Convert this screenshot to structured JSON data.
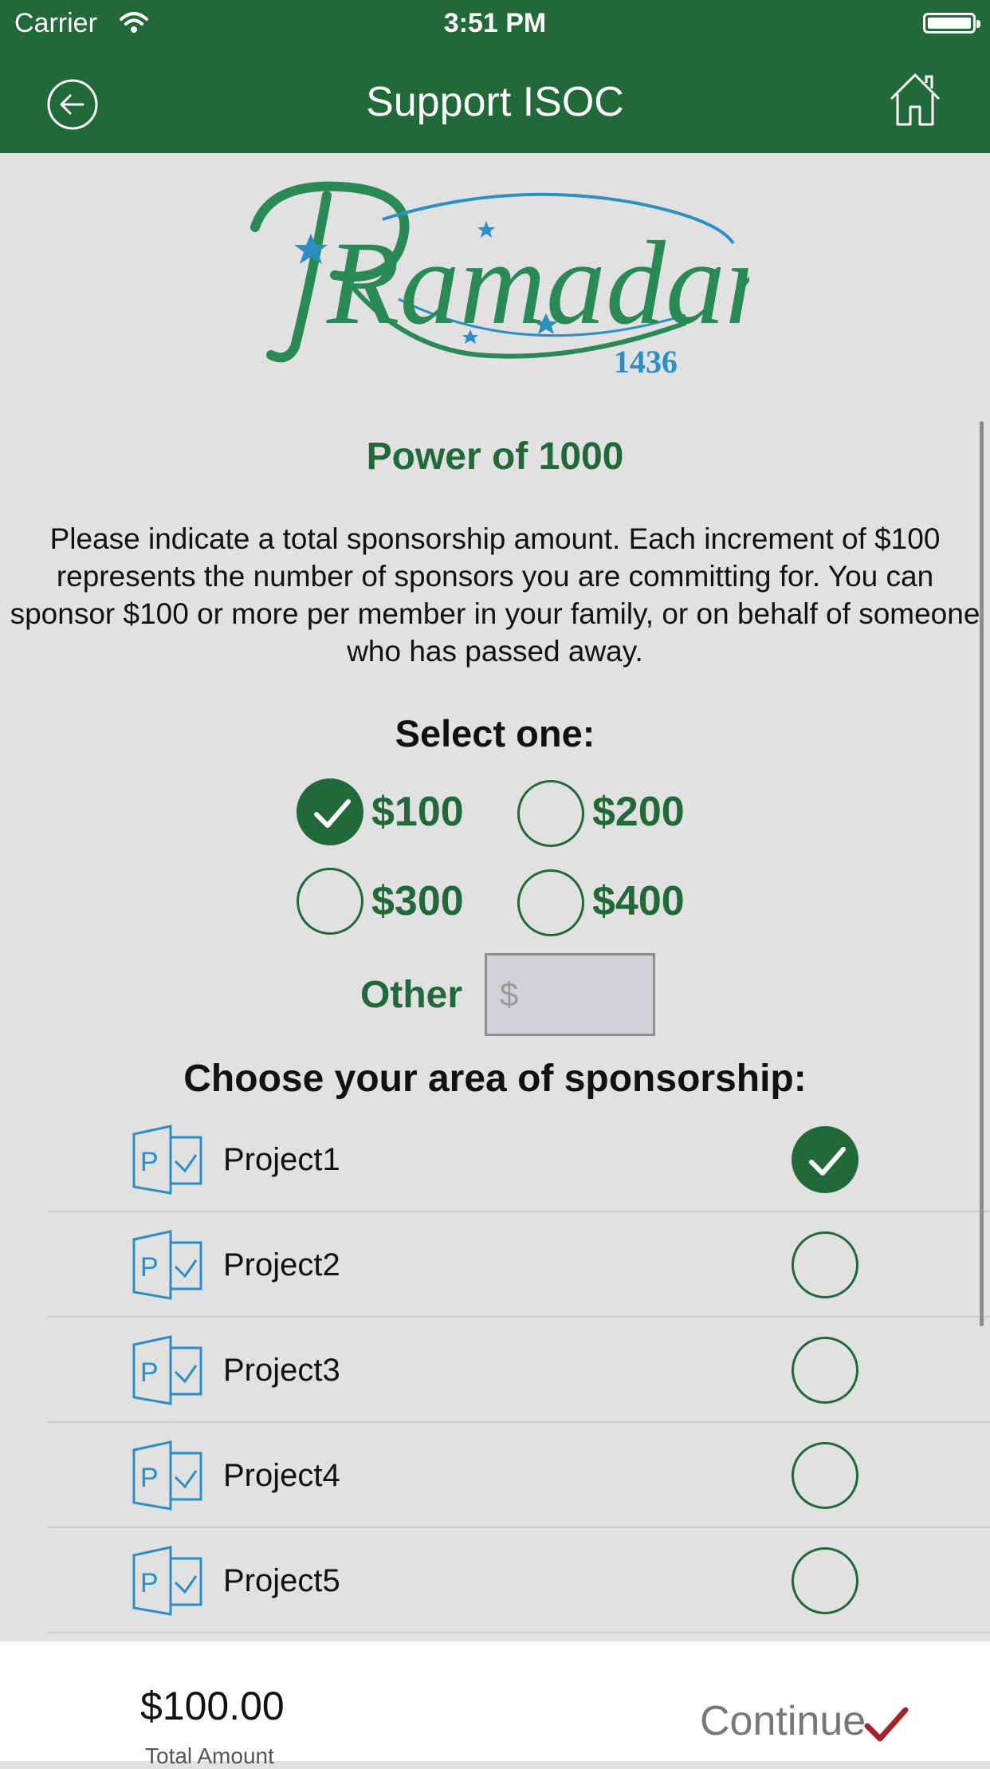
{
  "status_bar": {
    "carrier": "Carrier",
    "time": "3:51 PM"
  },
  "nav": {
    "title": "Support ISOC",
    "back_icon": "back-arrow-icon",
    "home_icon": "home-icon"
  },
  "logo": {
    "text": "Ramadan",
    "year": "1436"
  },
  "heading": "Power of 1000",
  "intro": "Please indicate a total sponsorship amount. Each increment of $100 represents the number of sponsors you are committing for. You can sponsor $100 or more per member in your family, or on behalf of someone who has passed away.",
  "select_label": "Select one:",
  "amounts": [
    {
      "label": "$100",
      "checked": true
    },
    {
      "label": "$200",
      "checked": false
    },
    {
      "label": "$300",
      "checked": false
    },
    {
      "label": "$400",
      "checked": false
    }
  ],
  "other": {
    "label": "Other",
    "placeholder": "$",
    "value": ""
  },
  "choose_label": "Choose your area of sponsorship:",
  "projects": [
    {
      "name": "Project1",
      "checked": true
    },
    {
      "name": "Project2",
      "checked": false
    },
    {
      "name": "Project3",
      "checked": false
    },
    {
      "name": "Project4",
      "checked": false
    },
    {
      "name": "Project5",
      "checked": false
    }
  ],
  "footer": {
    "total_value": "$100.00",
    "total_label": "Total Amount",
    "continue_label": "Continue"
  },
  "colors": {
    "brand_green": "#22693a",
    "accent_blue": "#2b8fc6",
    "continue_check": "#a8202a"
  }
}
